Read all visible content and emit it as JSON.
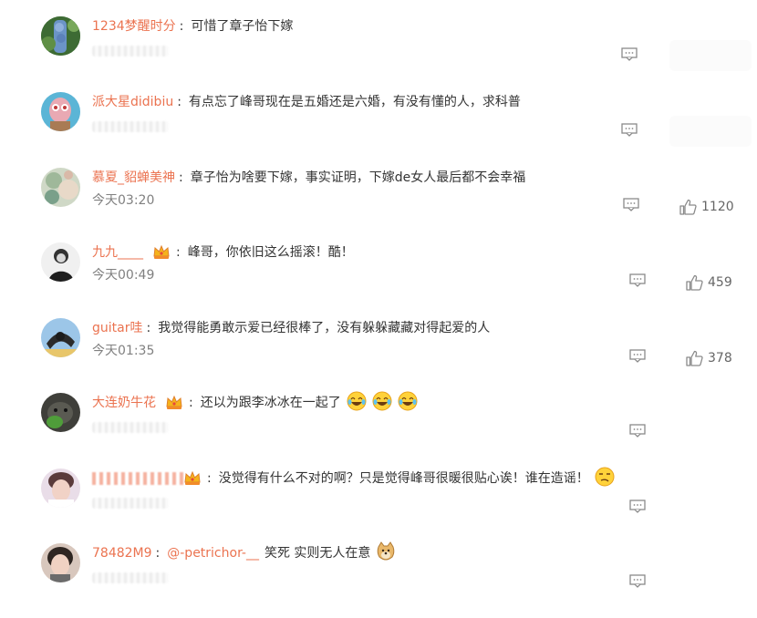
{
  "comments": [
    {
      "username": "1234梦醒时分",
      "text": "可惜了章子怡下嫁",
      "time": "",
      "likes": ""
    },
    {
      "username": "派大星didibiu",
      "text": "有点忘了峰哥现在是五婚还是六婚，有没有懂的人，求科普",
      "time": "",
      "likes": ""
    },
    {
      "username": "慕夏_貂蝉美神",
      "text": "章子怡为啥要下嫁，事实证明，下嫁de女人最后都不会幸福",
      "time": "今天03:20",
      "likes": "1120"
    },
    {
      "username": "九九____",
      "text": "峰哥，你依旧这么摇滚！酷！",
      "time": "今天00:49",
      "likes": "459"
    },
    {
      "username": "guitar哇",
      "text": "我觉得能勇敢示爱已经很棒了，没有躲躲藏藏对得起爱的人",
      "time": "今天01:35",
      "likes": "378"
    },
    {
      "username": "大连奶牛花",
      "text": "还以为跟李冰冰在一起了",
      "time": "",
      "likes": ""
    },
    {
      "username": "",
      "text": "没觉得有什么不对的啊？只是觉得峰哥很暖很贴心诶！谁在造谣！",
      "time": "",
      "likes": ""
    },
    {
      "username": "78482M9",
      "mention": "@-petrichor-__",
      "text": "笑死 实则无人在意",
      "time": "",
      "likes": ""
    }
  ],
  "separator": ":",
  "icons": {
    "reply": "comment-icon",
    "like": "thumbs-up-icon",
    "crown": "crown-badge-icon",
    "emoji_laugh": "laughing-tears-emoji",
    "emoji_smirk": "smirk-emoji",
    "emoji_doge": "doge-emoji"
  },
  "colors": {
    "username": "#eb7350",
    "text": "#333333",
    "time": "#808080",
    "icon": "#8a8a8a"
  }
}
